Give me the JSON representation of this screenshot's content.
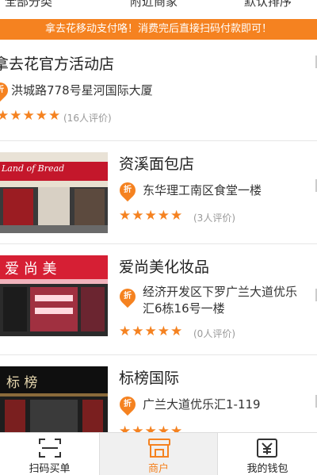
{
  "top_nav": {
    "tabs": [
      {
        "label": "全部分类"
      },
      {
        "label": "附近商家"
      },
      {
        "label": "默认排序"
      }
    ]
  },
  "notice": {
    "text": "拿去花移动支付咯！消费完后直接扫码付款即可！"
  },
  "merchants": [
    {
      "name": "拿去花官方活动店",
      "address": "洪城路778号星河国际大厦",
      "stars": 5,
      "reviews": "(16人评价)",
      "pin_glyph": "折"
    },
    {
      "name": "资溪面包店",
      "address": "东华理工南区食堂一楼",
      "stars": 5,
      "reviews": "(3人评价)",
      "pin_glyph": "折",
      "sign_text": "Land of Bread"
    },
    {
      "name": "爱尚美化妆品",
      "address": "经济开发区下罗广兰大道优乐汇6栋16号一楼",
      "stars": 5,
      "reviews": "(0人评价)",
      "pin_glyph": "折",
      "sign_text": "爱 尚 美"
    },
    {
      "name": "标榜国际",
      "address": "广兰大道优乐汇1-119",
      "stars": 5,
      "reviews": "",
      "pin_glyph": "折",
      "sign_text": "标 榜"
    }
  ],
  "star_glyphs": "★★★★★",
  "bottom_bar": {
    "tabs": [
      {
        "label": "扫码买单",
        "icon": "scan-icon"
      },
      {
        "label": "商户",
        "icon": "shop-icon"
      },
      {
        "label": "我的钱包",
        "icon": "wallet-icon"
      }
    ]
  },
  "colors": {
    "accent": "#f58220",
    "review_text": "#999999"
  }
}
